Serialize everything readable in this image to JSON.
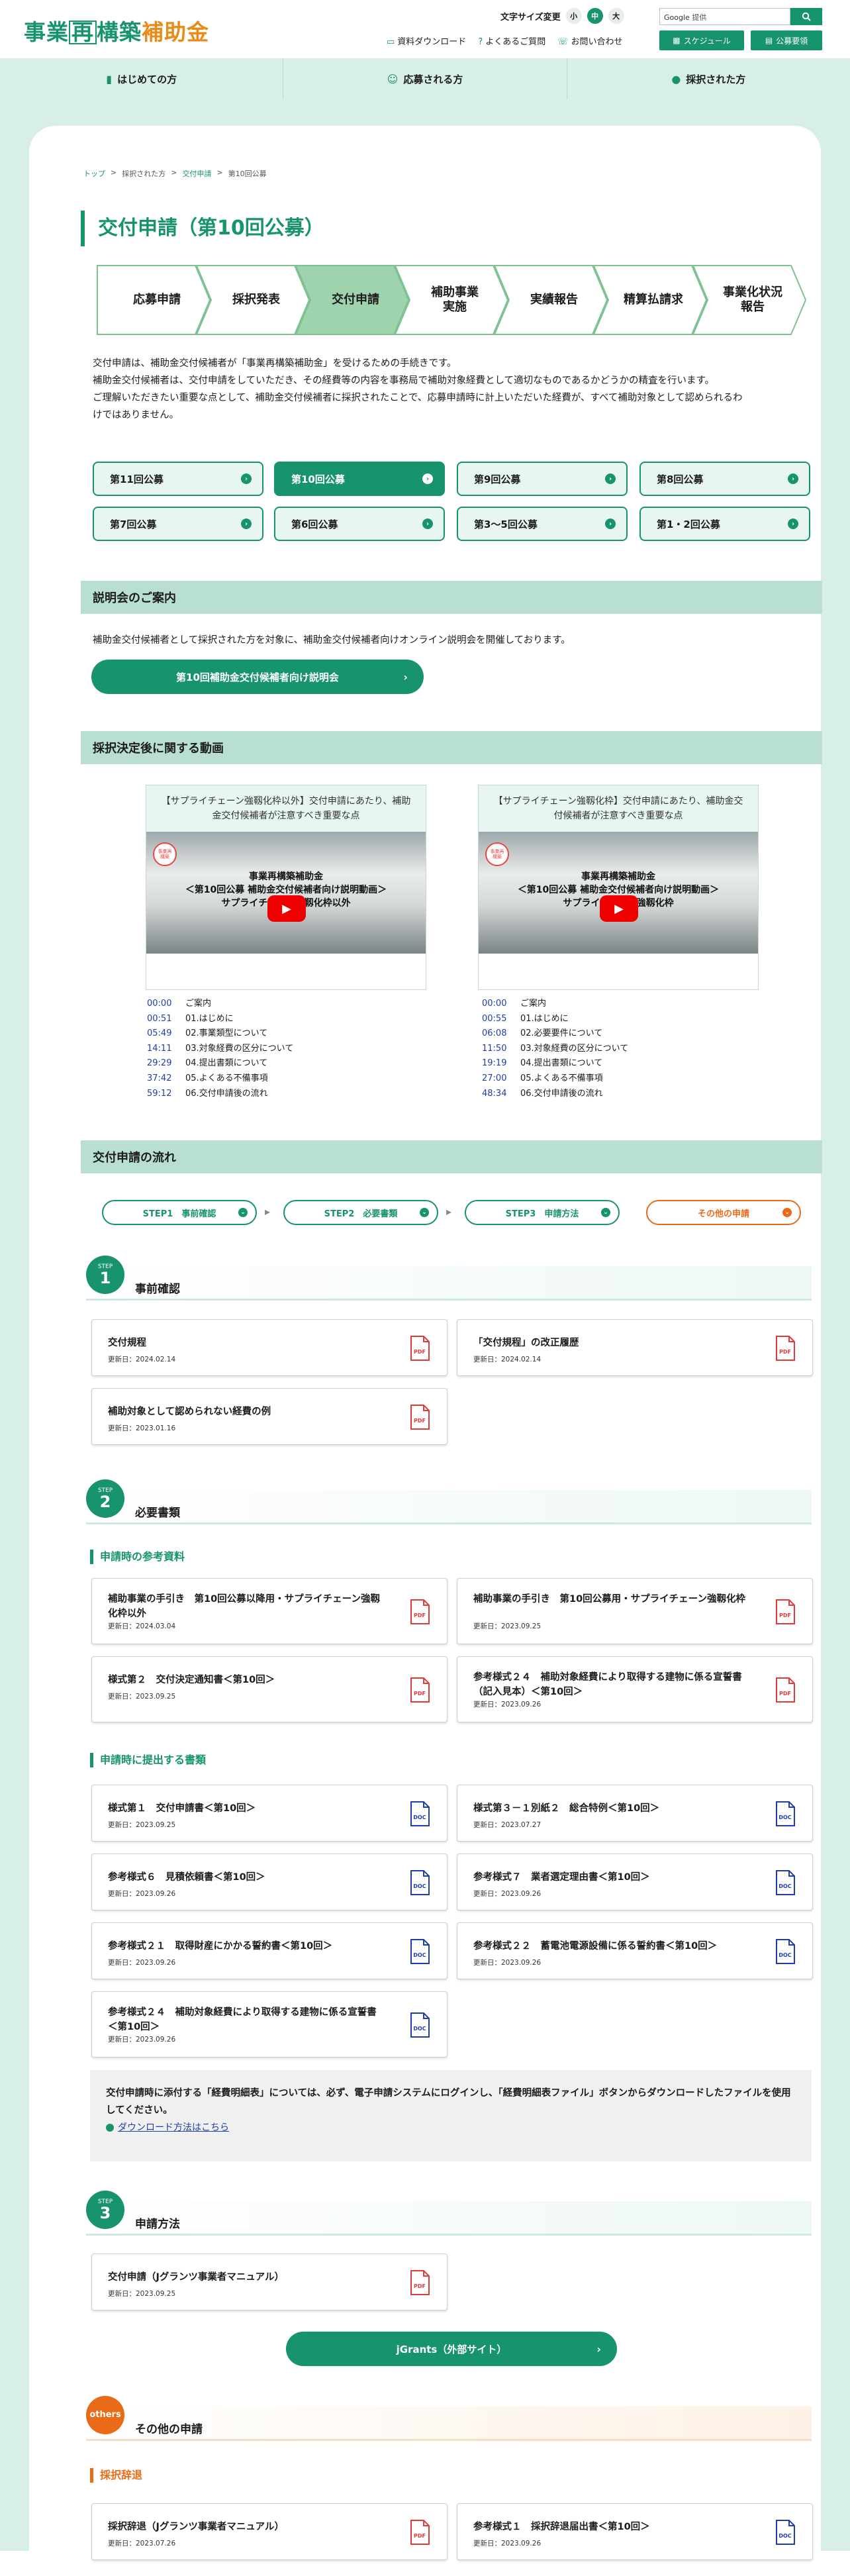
{
  "header": {
    "logo": {
      "part1": "事業",
      "boxed": "再",
      "part2": "構築",
      "part3": "補助金"
    },
    "font_size_label": "文字サイズ変更",
    "font_sizes": [
      "小",
      "中",
      "大"
    ],
    "search_placeholder_brand": "Google",
    "search_placeholder": "提供",
    "links": [
      "資料ダウンロード",
      "よくあるご質問",
      "お問い合わせ"
    ],
    "buttons": [
      "スケジュール",
      "公募要領"
    ]
  },
  "nav": [
    "はじめての方",
    "応募される方",
    "採択された方"
  ],
  "breadcrumb": [
    "トップ",
    "採択された方",
    "交付申請",
    "第10回公募"
  ],
  "page_title": "交付申請（第10回公募）",
  "process_steps": [
    "応募申請",
    "採択発表",
    "交付申請",
    "補助事業\n実施",
    "実績報告",
    "精算払請求",
    "事業化状況\n報告"
  ],
  "intro": [
    "交付申請は、補助金交付候補者が「事業再構築補助金」を受けるための手続きです。",
    "補助金交付候補者は、交付申請をしていただき、その経費等の内容を事務局で補助対象経費として適切なものであるかどうかの精査を行います。",
    "ご理解いただきたい重要な点として、補助金交付候補者に採択されたことで、応募申請時に計上いただいた経費が、すべて補助対象として認められるわ",
    "けではありません。"
  ],
  "round_tabs": [
    "第11回公募",
    "第10回公募",
    "第9回公募",
    "第8回公募",
    "第7回公募",
    "第6回公募",
    "第3〜5回公募",
    "第1・2回公募"
  ],
  "briefing": {
    "heading": "説明会のご案内",
    "text": "補助金交付候補者として採択された方を対象に、補助金交付候補者向けオンライン説明会を開催しております。",
    "button": "第10回補助金交付候補者向け説明会"
  },
  "videos_section": {
    "heading": "採択決定後に関する動画",
    "videos": [
      {
        "title": "【サプライチェーン強靱化枠以外】交付申請にあたり、補助金交付候補者が注意すべき重要な点",
        "caption": [
          "事業再構築補助金",
          "＜第10回公募 補助金交付候補者向け説明動画＞",
          "サプライチェーン強靱化枠以外"
        ],
        "chapters": [
          [
            "00:00",
            "ご案内"
          ],
          [
            "00:51",
            "01.はじめに"
          ],
          [
            "05:49",
            "02.事業類型について"
          ],
          [
            "14:11",
            "03.対象経費の区分について"
          ],
          [
            "29:29",
            "04.提出書類について"
          ],
          [
            "37:42",
            "05.よくある不備事項"
          ],
          [
            "59:12",
            "06.交付申請後の流れ"
          ]
        ]
      },
      {
        "title": "【サプライチェーン強靱化枠】交付申請にあたり、補助金交付候補者が注意すべき重要な点",
        "caption": [
          "事業再構築補助金",
          "＜第10回公募 補助金交付候補者向け説明動画＞",
          "サプライチェーン強靱化枠"
        ],
        "chapters": [
          [
            "00:00",
            "ご案内"
          ],
          [
            "00:55",
            "01.はじめに"
          ],
          [
            "06:08",
            "02.必要要件について"
          ],
          [
            "11:50",
            "03.対象経費の区分について"
          ],
          [
            "19:19",
            "04.提出書類について"
          ],
          [
            "27:00",
            "05.よくある不備事項"
          ],
          [
            "48:34",
            "06.交付申請後の流れ"
          ]
        ]
      }
    ]
  },
  "flow": {
    "heading": "交付申請の流れ",
    "pills": [
      "STEP1　事前確認",
      "STEP2　必要書類",
      "STEP3　申請方法",
      "その他の申請"
    ]
  },
  "step1": {
    "label": "STEP",
    "num": "1",
    "title": "事前確認",
    "docs": [
      {
        "title": "交付規程",
        "date": "更新日：2024.02.14",
        "type": "PDF"
      },
      {
        "title": "「交付規程」の改正履歴",
        "date": "更新日：2024.02.14",
        "type": "PDF"
      },
      {
        "title": "補助対象として認められない経費の例",
        "date": "更新日：2023.01.16",
        "type": "PDF"
      }
    ]
  },
  "step2": {
    "label": "STEP",
    "num": "2",
    "title": "必要書類",
    "sub1": "申請時の参考資料",
    "ref_docs": [
      {
        "title": "補助事業の手引き　第10回公募以降用・サプライチェーン強靱化枠以外",
        "date": "更新日：2024.03.04",
        "type": "PDF"
      },
      {
        "title": "補助事業の手引き　第10回公募用・サプライチェーン強靱化枠",
        "date": "更新日：2023.09.25",
        "type": "PDF"
      },
      {
        "title": "様式第２　交付決定通知書＜第10回＞",
        "date": "更新日：2023.09.25",
        "type": "PDF"
      },
      {
        "title": "参考様式２４　補助対象経費により取得する建物に係る宣誓書（記入見本）＜第10回＞",
        "date": "更新日：2023.09.26",
        "type": "PDF"
      }
    ],
    "sub2": "申請時に提出する書類",
    "submit_docs": [
      {
        "title": "様式第１　交付申請書＜第10回＞",
        "date": "更新日：2023.09.25",
        "type": "DOC"
      },
      {
        "title": "様式第３－１別紙２　総合特例＜第10回＞",
        "date": "更新日：2023.07.27",
        "type": "DOC"
      },
      {
        "title": "参考様式６　見積依頼書＜第10回＞",
        "date": "更新日：2023.09.26",
        "type": "DOC"
      },
      {
        "title": "参考様式７　業者選定理由書＜第10回＞",
        "date": "更新日：2023.09.26",
        "type": "DOC"
      },
      {
        "title": "参考様式２１　取得財産にかかる誓約書＜第10回＞",
        "date": "更新日：2023.09.26",
        "type": "DOC"
      },
      {
        "title": "参考様式２２　蓄電池電源設備に係る誓約書＜第10回＞",
        "date": "更新日：2023.09.26",
        "type": "DOC"
      },
      {
        "title": "参考様式２４　補助対象経費により取得する建物に係る宣誓書＜第10回＞",
        "date": "更新日：2023.09.26",
        "type": "DOC"
      }
    ],
    "note": "交付申請時に添付する「経費明細表」については、必ず、電子申請システムにログインし、「経費明細表ファイル」ボタンからダウンロードしたファイルを使用してください。",
    "note_link": "ダウンロード方法はこちら"
  },
  "step3": {
    "label": "STEP",
    "num": "3",
    "title": "申請方法",
    "docs": [
      {
        "title": "交付申請（Jグランツ事業者マニュアル）",
        "date": "更新日：2023.09.25",
        "type": "PDF"
      }
    ],
    "button": "jGrants（外部サイト）"
  },
  "others": {
    "label": "others",
    "title": "その他の申請",
    "sub": "採択辞退",
    "docs": [
      {
        "title": "採択辞退（Jグランツ事業者マニュアル）",
        "date": "更新日：2023.07.26",
        "type": "PDF"
      },
      {
        "title": "参考様式１　採択辞退届出書＜第10回＞",
        "date": "更新日：2023.09.26",
        "type": "DOC"
      }
    ]
  },
  "colors": {
    "primary": "#17936d",
    "accent": "#ea8a17",
    "orange": "#ea6b17",
    "nav_bg": "#d7efe7",
    "pdf_red": "#e23b3b",
    "doc_blue": "#1f3ea8"
  }
}
